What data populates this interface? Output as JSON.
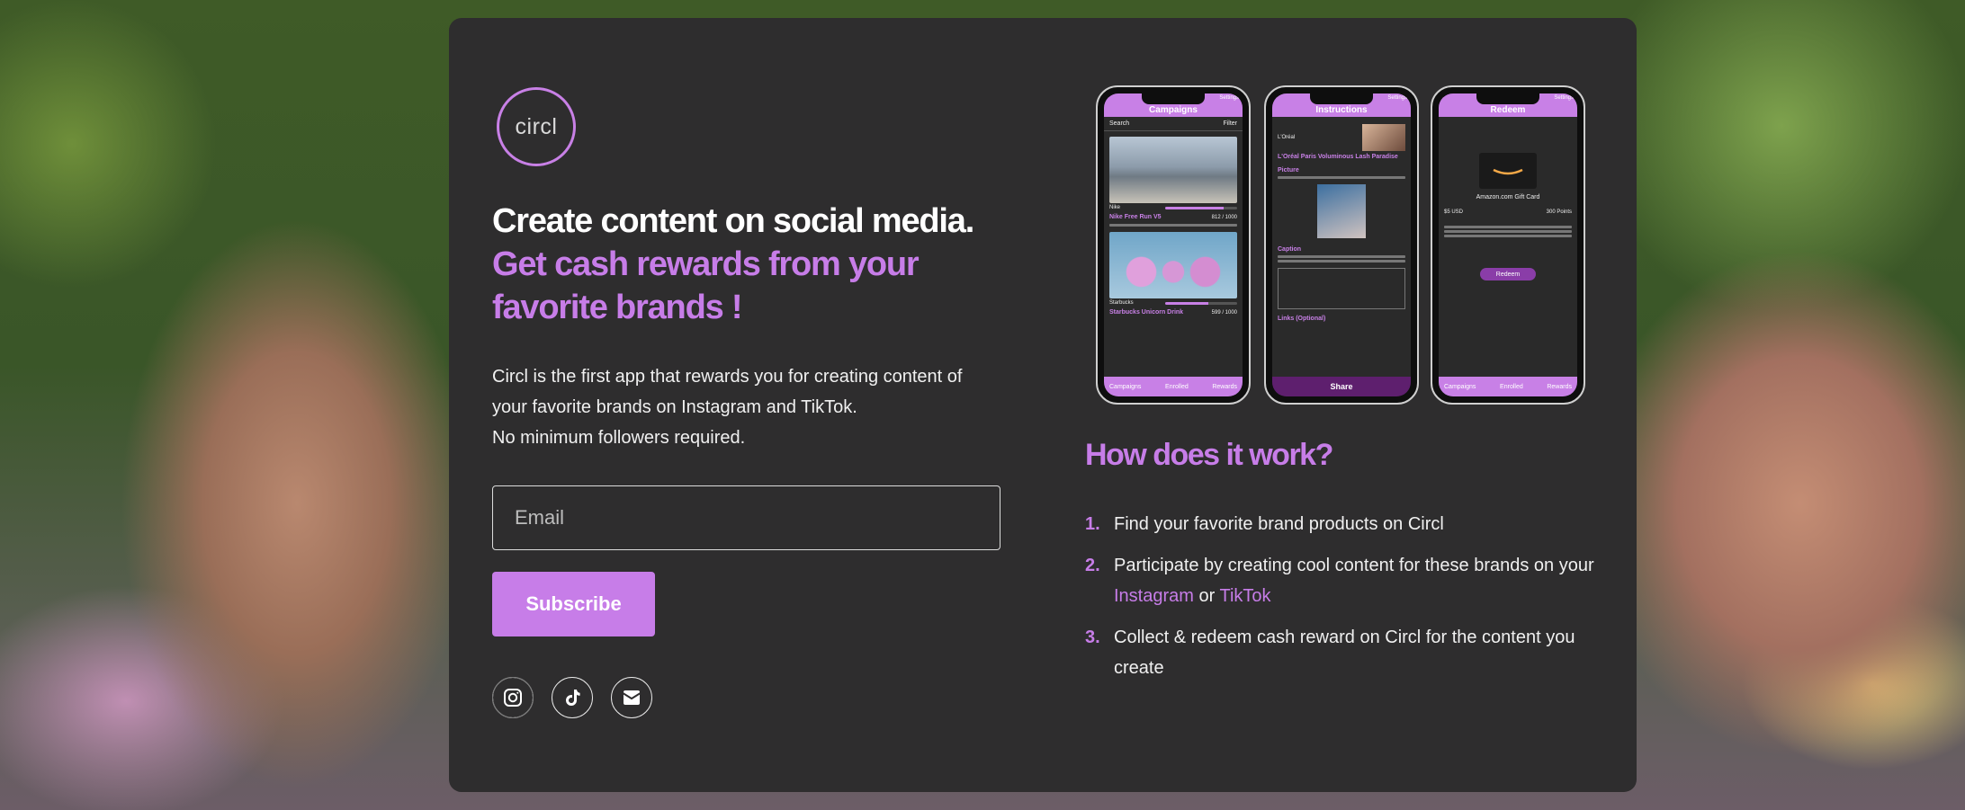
{
  "hero": {
    "logo_text": "circl",
    "headline_white": "Create content on social media.",
    "headline_purple": "Get cash rewards from your favorite brands !",
    "description_lines": [
      "Circl is the first app that rewards you for creating content of",
      "your favorite brands on Instagram and TikTok.",
      "No minimum followers required."
    ]
  },
  "form": {
    "email_placeholder": "Email",
    "email_value": "",
    "subscribe_label": "Subscribe"
  },
  "social": [
    {
      "icon": "instagram-icon"
    },
    {
      "icon": "tiktok-icon"
    },
    {
      "icon": "email-icon"
    }
  ],
  "phones": {
    "campaigns": {
      "title": "Campaigns",
      "settings": "Settings",
      "search": "Search",
      "filter": "Filter",
      "item1_brand": "Nike",
      "item1_progress": "812 / 1000",
      "item1_progress_value": 0.812,
      "item1_product": "Nike Free Run V5",
      "item2_brand": "Starbucks",
      "item2_progress": "599 / 1000",
      "item2_progress_value": 0.599,
      "item2_product": "Starbucks Unicorn Drink",
      "tabs": [
        "Campaigns",
        "Enrolled",
        "Rewards"
      ]
    },
    "instructions": {
      "title": "Instructions",
      "settings": "Settings",
      "brand": "L'Oréal",
      "product": "L'Oréal Paris Voluminous Lash Paradise",
      "picture_label": "Picture",
      "caption_label": "Caption",
      "links_label": "Links (Optional)",
      "share_label": "Share"
    },
    "redeem": {
      "title": "Redeem",
      "settings": "Settings",
      "card_name": "Amazon.com Gift Card",
      "amount": "$5 USD",
      "points": "300 Points",
      "button": "Redeem",
      "tabs": [
        "Campaigns",
        "Enrolled",
        "Rewards"
      ]
    }
  },
  "how": {
    "title": "How does it work?",
    "steps": [
      {
        "num": "1.",
        "text": "Find your favorite brand products on Circl"
      },
      {
        "num": "2.",
        "text_before": "Participate by creating cool content for these brands on your",
        "link1": "Instagram",
        "or": "or",
        "link2": "TikTok"
      },
      {
        "num": "3.",
        "text": "Collect & redeem cash reward on Circl for the content you create"
      }
    ]
  },
  "colors": {
    "accent": "#c77de8",
    "card_bg": "#2e2d2e",
    "text": "#f0f0f0"
  }
}
